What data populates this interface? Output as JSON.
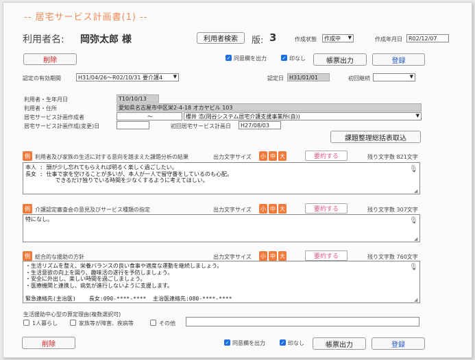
{
  "page": {
    "title": "-- 居宅サービス計画書(1) --",
    "user_label": "利用者名:",
    "user_name": "岡弥太郎 様",
    "user_search_label": "利用者検索",
    "version_label": "版:",
    "version_value": "3",
    "status_label": "作成状態",
    "status_value": "作成中",
    "created_date_label": "作成年月日",
    "created_date_value": "R02/12/07"
  },
  "toolbar": {
    "delete_label": "削除",
    "consent_label": "同意欄を出力",
    "consent_checked": true,
    "no_seal_label": "印なし",
    "no_seal_checked": true,
    "print_label": "帳票出力",
    "register_label": "登録"
  },
  "cert": {
    "period_label": "認定の有効期間",
    "period_value": "H31/04/26～R02/10/31 要介護4",
    "cert_date_label": "認定日",
    "cert_date_value": "H31/01/01",
    "first_label": "初回継続",
    "first_value": ""
  },
  "info": {
    "birth_label": "利用者・生年月日",
    "birth_value": "T10/10/13",
    "address_label": "利用者・住所",
    "address_value": "愛知県名古屋市中区栄2-4-18 オカヤビル 103",
    "planner_label": "居宅サービス計画作成者",
    "planner_tilde": "～",
    "planner_value": "櫻井 浩(岡谷システム居宅介護支援事業所(自))",
    "change_date_label": "居宅サービス計画作成(変更)日",
    "change_date_value": "",
    "first_plan_label": "初回居宅サービス計画日",
    "first_plan_value": "H27/08/03",
    "import_label": "課題整理総括表取込"
  },
  "sections": [
    {
      "heading": "利用者及び家族の生活に対する意向を踏まえた課題分析の結果",
      "example_icon": "例",
      "font_size_label": "出力文字サイズ",
      "summarize_label": "要約する",
      "remaining_label": "残り文字数 821文字",
      "text": "本人 : 頭が少し忘れてもらえれば明るく楽しく過ごしたい。\n長女 : 仕事で家を空けることが多いが、本人が一人で留守番をしているのも心配。\n         できるだけ独りでいる時間を少なくするように考えてほしい。"
    },
    {
      "heading": "介護認定審査会の意見及びサービス種類の指定",
      "example_icon": "例",
      "font_size_label": "出力文字サイズ",
      "summarize_label": "要約する",
      "remaining_label": "残り文字数 307文字",
      "text": "特になし。"
    },
    {
      "heading": "総合的な援助の方針",
      "example_icon": "例",
      "font_size_label": "出力文字サイズ",
      "summarize_label": "要約する",
      "remaining_label": "残り文字数 760文字",
      "text": "・生活リズムを整え、栄養バランスの良い食事や適度な運動を継続しましょう。\n・生活意欲の向上を図り、趣味活の遂行を予防しましょう。\n・安全に外出し、楽しい時間を過ごしましょう。\n・医療機関と連携し、病気が進行しないように支援します。\n\n緊急連絡先(主治医)    長女:090-****-****  主治医連絡先:080-****-****"
    }
  ],
  "size_buttons": [
    "小",
    "中",
    "大"
  ],
  "reason": {
    "label": "生活援助中心型の算定理由(複数選択可)",
    "options": [
      {
        "label": "1人暮らし",
        "checked": false
      },
      {
        "label": "家族等が障害、疾病等",
        "checked": false
      },
      {
        "label": "その他",
        "checked": false
      }
    ],
    "other_value": ""
  },
  "colors": {
    "accent": "#f07a3a",
    "title": "#f08a55",
    "delete_text": "#d21f1f",
    "register_text": "#1b4fc0",
    "summarize_text": "#e0558a"
  }
}
